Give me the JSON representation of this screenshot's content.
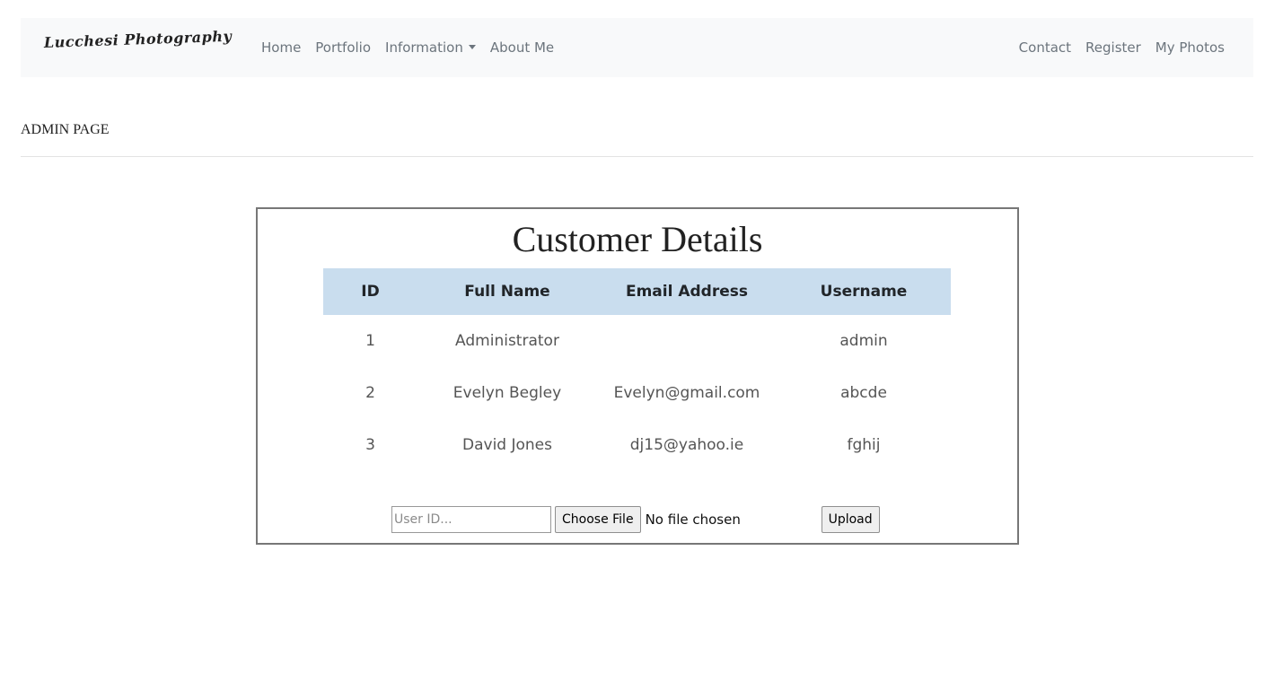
{
  "navbar": {
    "brand": "Lucchesi Photography",
    "left_links": [
      "Home",
      "Portfolio",
      "Information",
      "About Me"
    ],
    "right_links": [
      "Contact",
      "Register",
      "My Photos"
    ]
  },
  "page": {
    "heading": "ADMIN PAGE"
  },
  "panel": {
    "title": "Customer Details",
    "columns": [
      "ID",
      "Full Name",
      "Email Address",
      "Username"
    ],
    "rows": [
      {
        "id": "1",
        "full_name": "Administrator",
        "email": "",
        "username": "admin"
      },
      {
        "id": "2",
        "full_name": "Evelyn Begley",
        "email": "Evelyn@gmail.com",
        "username": "abcde"
      },
      {
        "id": "3",
        "full_name": "David Jones",
        "email": "dj15@yahoo.ie",
        "username": "fghij"
      }
    ],
    "upload": {
      "userid_placeholder": "User ID...",
      "choose_file_label": "Choose File",
      "file_status": "No file chosen",
      "upload_label": "Upload"
    }
  },
  "colors": {
    "navbar_bg": "#f8f9fa",
    "table_header_bg": "#c9ddee",
    "nav_link": "#6c757d"
  },
  "icons": {
    "dropdown": "caret-down-icon"
  }
}
